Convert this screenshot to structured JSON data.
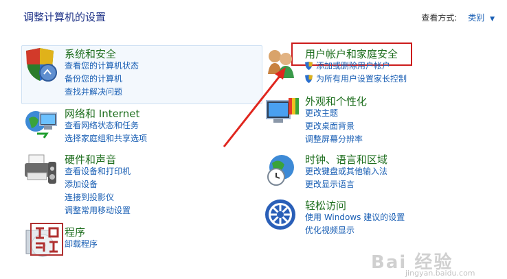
{
  "header": {
    "title": "调整计算机的设置",
    "view_by_label": "查看方式:",
    "view_by_value": "类别"
  },
  "categories": [
    {
      "title": "系统和安全",
      "icon": "shield-check-icon",
      "links": [
        "查看您的计算机状态",
        "备份您的计算机",
        "查找并解决问题"
      ]
    },
    {
      "title": "网络和 Internet",
      "icon": "network-globe-icon",
      "links": [
        "查看网络状态和任务",
        "选择家庭组和共享选项"
      ]
    },
    {
      "title": "硬件和声音",
      "icon": "printer-icon",
      "links": [
        "查看设备和打印机",
        "添加设备",
        "连接到投影仪",
        "调整常用移动设置"
      ]
    },
    {
      "title": "程序",
      "icon": "programs-icon",
      "links": [
        "卸载程序"
      ]
    },
    {
      "title": "用户帐户和家庭安全",
      "icon": "users-icon",
      "links": [
        "添加或删除用户帐户",
        "为所有用户设置家长控制"
      ]
    },
    {
      "title": "外观和个性化",
      "icon": "monitor-palette-icon",
      "links": [
        "更改主题",
        "更改桌面背景",
        "调整屏幕分辨率"
      ]
    },
    {
      "title": "时钟、语言和区域",
      "icon": "clock-globe-icon",
      "links": [
        "更改键盘或其他输入法",
        "更改显示语言"
      ]
    },
    {
      "title": "轻松访问",
      "icon": "ease-of-access-icon",
      "links": [
        "使用 Windows 建议的设置",
        "优化视频显示"
      ]
    }
  ],
  "watermark": {
    "text": "Bai 经验",
    "sub": "jingyan.baidu.com"
  },
  "colors": {
    "title_green": "#1e6e1e",
    "link_blue": "#1a5fb4",
    "highlight_red": "#cc1b1b"
  }
}
